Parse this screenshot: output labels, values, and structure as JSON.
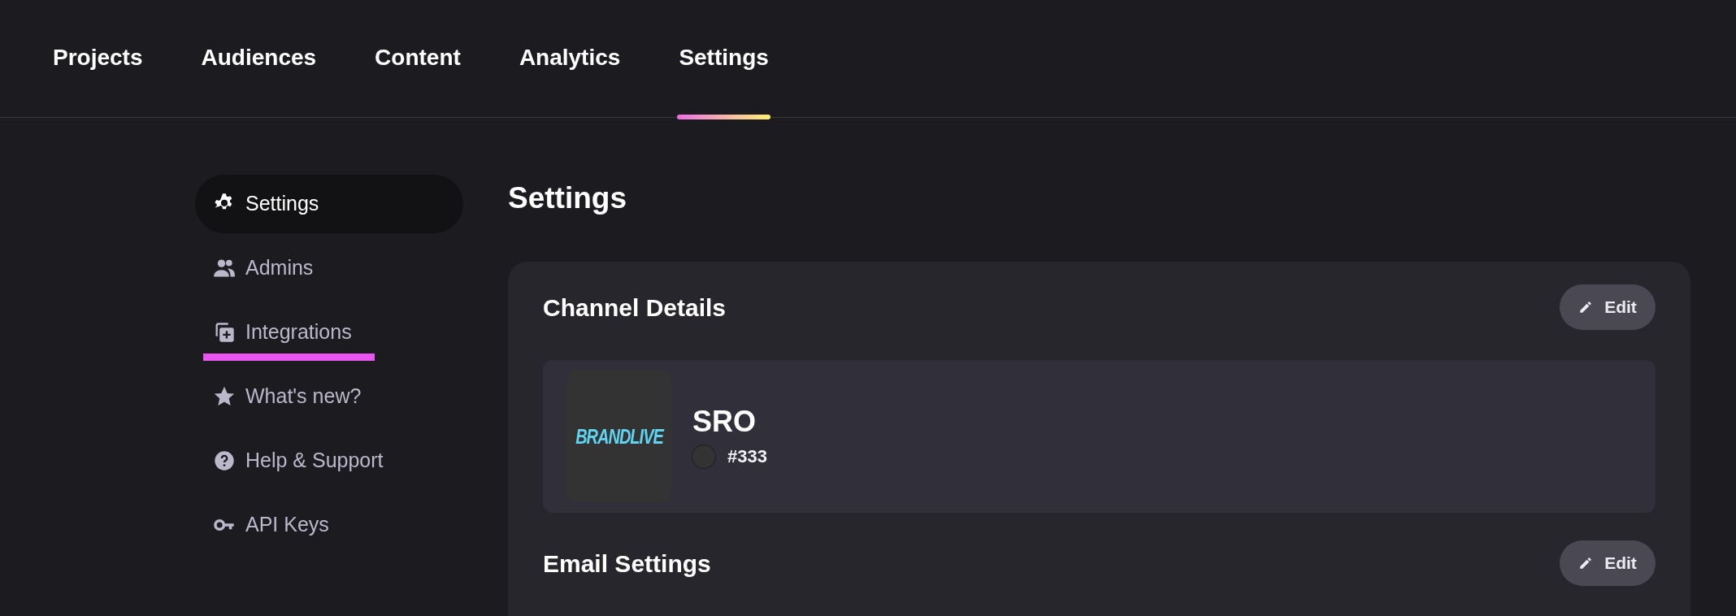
{
  "tabs": [
    {
      "label": "Projects",
      "selected": false
    },
    {
      "label": "Audiences",
      "selected": false
    },
    {
      "label": "Content",
      "selected": false
    },
    {
      "label": "Analytics",
      "selected": false
    },
    {
      "label": "Settings",
      "selected": true
    }
  ],
  "sidebar": {
    "items": [
      {
        "kind": "gear",
        "label": "Settings",
        "selected": true,
        "highlighted": false
      },
      {
        "kind": "people",
        "label": "Admins",
        "selected": false,
        "highlighted": false
      },
      {
        "kind": "integrations",
        "label": "Integrations",
        "selected": false,
        "highlighted": true
      },
      {
        "kind": "star",
        "label": "What's new?",
        "selected": false,
        "highlighted": false
      },
      {
        "kind": "help",
        "label": "Help & Support",
        "selected": false,
        "highlighted": false
      },
      {
        "kind": "key",
        "label": "API Keys",
        "selected": false,
        "highlighted": false
      }
    ]
  },
  "page_title": "Settings",
  "sections": [
    {
      "title": "Channel Details",
      "edit_button": "Edit",
      "channel": {
        "logo_text": "BRANDLIVE",
        "name": "SRO",
        "color": "#333333",
        "color_label": "#333"
      }
    },
    {
      "title": "Email Settings",
      "edit_button": "Edit"
    }
  ]
}
